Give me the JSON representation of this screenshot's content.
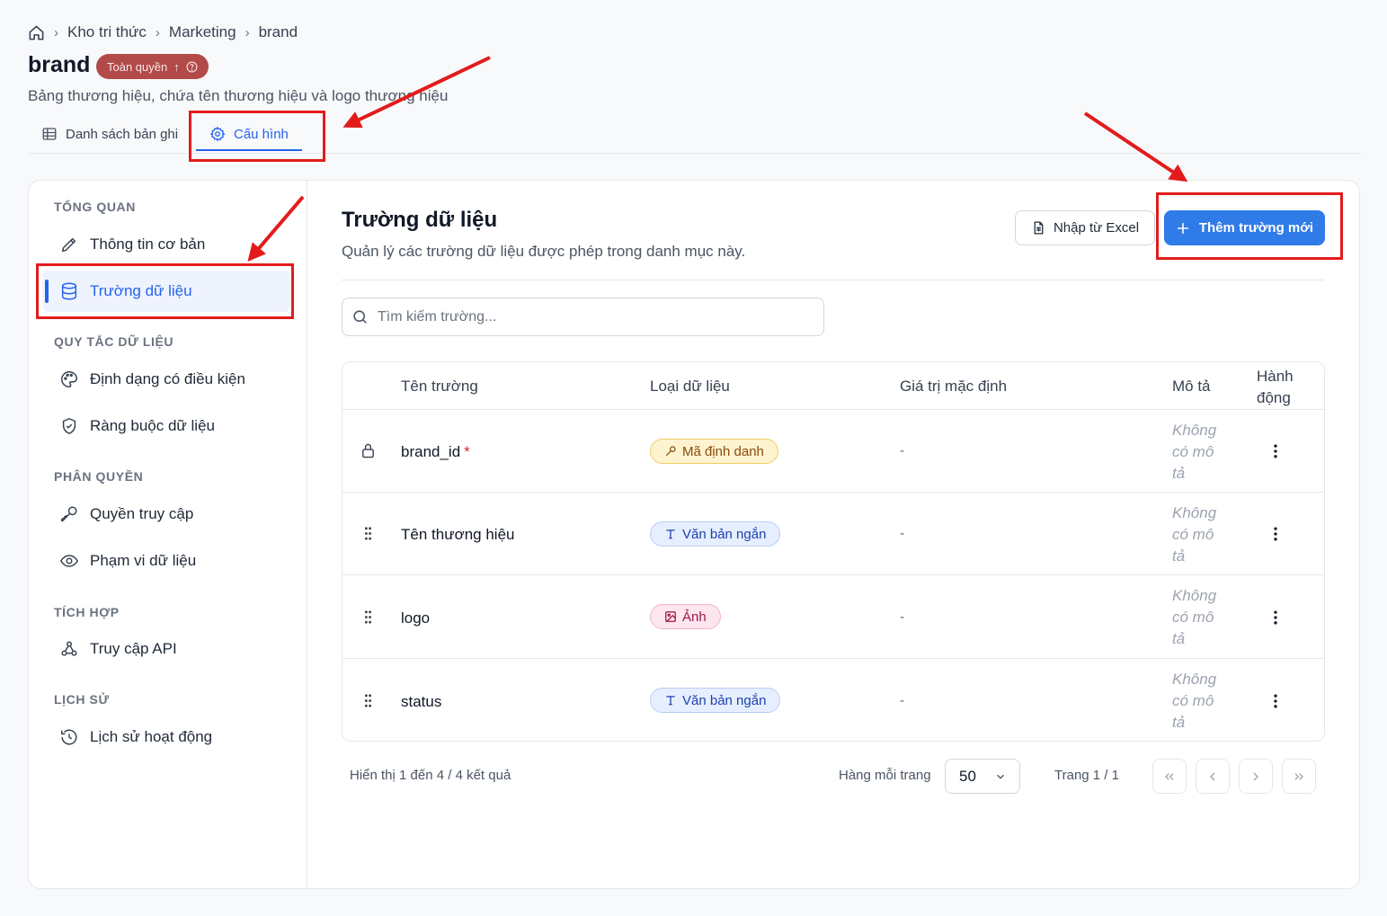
{
  "breadcrumb": [
    "Kho tri thức",
    "Marketing",
    "brand"
  ],
  "page": {
    "title": "brand",
    "permission_badge": "Toàn quyền",
    "subtitle": "Bảng thương hiệu, chứa tên thương hiệu và logo thương hiệu"
  },
  "tabs": [
    {
      "label": "Danh sách bản ghi",
      "active": false
    },
    {
      "label": "Cấu hình",
      "active": true
    }
  ],
  "sidebar": {
    "sections": [
      {
        "heading": "TỔNG QUAN",
        "items": [
          {
            "label": "Thông tin cơ bản",
            "icon": "pencil-icon"
          },
          {
            "label": "Trường dữ liệu",
            "icon": "database-icon",
            "active": true
          }
        ]
      },
      {
        "heading": "QUY TẮC DỮ LIỆU",
        "items": [
          {
            "label": "Định dạng có điều kiện",
            "icon": "palette-icon"
          },
          {
            "label": "Ràng buộc dữ liệu",
            "icon": "shield-check-icon"
          }
        ]
      },
      {
        "heading": "PHÂN QUYỀN",
        "items": [
          {
            "label": "Quyền truy cập",
            "icon": "key-icon"
          },
          {
            "label": "Phạm vi dữ liệu",
            "icon": "eye-icon"
          }
        ]
      },
      {
        "heading": "TÍCH HỢP",
        "items": [
          {
            "label": "Truy cập API",
            "icon": "webhook-icon"
          }
        ]
      },
      {
        "heading": "LỊCH SỬ",
        "items": [
          {
            "label": "Lịch sử hoạt động",
            "icon": "history-icon"
          }
        ]
      }
    ]
  },
  "content": {
    "title": "Trường dữ liệu",
    "subtitle": "Quản lý các trường dữ liệu được phép trong danh mục này.",
    "import_label": "Nhập từ Excel",
    "add_label": "Thêm trường mới",
    "search_placeholder": "Tìm kiếm trường..."
  },
  "table": {
    "headers": [
      "Tên trường",
      "Loại dữ liệu",
      "Giá trị mặc định",
      "Mô tả",
      "Hành động"
    ],
    "rows": [
      {
        "name": "brand_id",
        "required": true,
        "locked": true,
        "type": "Mã định danh",
        "type_kind": "key",
        "default": "-",
        "description": "Không có mô tả"
      },
      {
        "name": "Tên thương hiệu",
        "required": false,
        "locked": false,
        "type": "Văn bản ngắn",
        "type_kind": "text",
        "default": "-",
        "description": "Không có mô tả"
      },
      {
        "name": "logo",
        "required": false,
        "locked": false,
        "type": "Ảnh",
        "type_kind": "image",
        "default": "-",
        "description": "Không có mô tả"
      },
      {
        "name": "status",
        "required": false,
        "locked": false,
        "type": "Văn bản ngắn",
        "type_kind": "text",
        "default": "-",
        "description": "Không có mô tả"
      }
    ]
  },
  "footer": {
    "info": "Hiển thị 1 đến 4 / 4 kết quả",
    "per_page_label": "Hàng mỗi trang",
    "per_page_value": "50",
    "page_label": "Trang 1 / 1"
  },
  "colors": {
    "accent": "#2563eb",
    "primary_button": "#2f7be8",
    "permission_badge": "#b24a4a",
    "annotation_red": "#e31b1b"
  }
}
